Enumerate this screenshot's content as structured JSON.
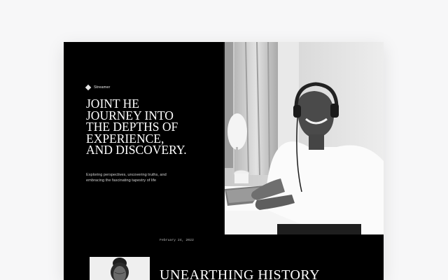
{
  "brand": {
    "name": "Streamer",
    "icon": "diamond-icon"
  },
  "hero": {
    "headline_lines": [
      "JOINT HE",
      "JOURNEY INTO",
      "THE DEPTHS OF",
      "EXPERIENCE,",
      "AND DISCOVERY."
    ],
    "subtitle_lines": [
      "Exploring perspectives, uncovering truths, and",
      "embracing the fascinating tapestry of life"
    ]
  },
  "article": {
    "date": "February 24, 2022",
    "title": "UNEARTHING HISTORY"
  },
  "colors": {
    "background": "#000000",
    "text": "#ffffff",
    "page": "#f7f7f8"
  }
}
